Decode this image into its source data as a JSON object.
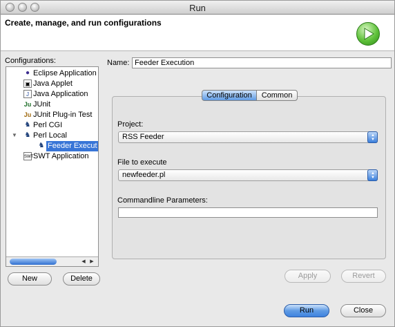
{
  "window": {
    "title": "Run"
  },
  "banner": {
    "title": "Create, manage, and run configurations",
    "run_icon": "run-play-icon",
    "accent": "#3aa52a"
  },
  "sidebar": {
    "label": "Configurations:",
    "items": [
      {
        "label": "Eclipse Application",
        "icon": "eclipse-icon"
      },
      {
        "label": "Java Applet",
        "icon": "applet-icon"
      },
      {
        "label": "Java Application",
        "icon": "java-app-icon"
      },
      {
        "label": "JUnit",
        "icon": "junit-icon"
      },
      {
        "label": "JUnit Plug-in Test",
        "icon": "junit-plugin-icon"
      },
      {
        "label": "Perl CGI",
        "icon": "perl-camel-icon"
      },
      {
        "label": "Perl Local",
        "icon": "perl-camel-icon"
      },
      {
        "label": "Feeder Execut",
        "icon": "perl-camel-icon"
      },
      {
        "label": "SWT Application",
        "icon": "swt-icon"
      }
    ],
    "new_label": "New",
    "delete_label": "Delete"
  },
  "form": {
    "name_label": "Name:",
    "name_value": "Feeder Execution",
    "tabs": [
      "Configuration",
      "Common"
    ],
    "project_label": "Project:",
    "project_value": "RSS Feeder",
    "file_label": "File to execute",
    "file_value": "newfeeder.pl",
    "params_label": "Commandline Parameters:",
    "params_value": "",
    "apply_label": "Apply",
    "revert_label": "Revert"
  },
  "footer": {
    "run_label": "Run",
    "close_label": "Close"
  }
}
